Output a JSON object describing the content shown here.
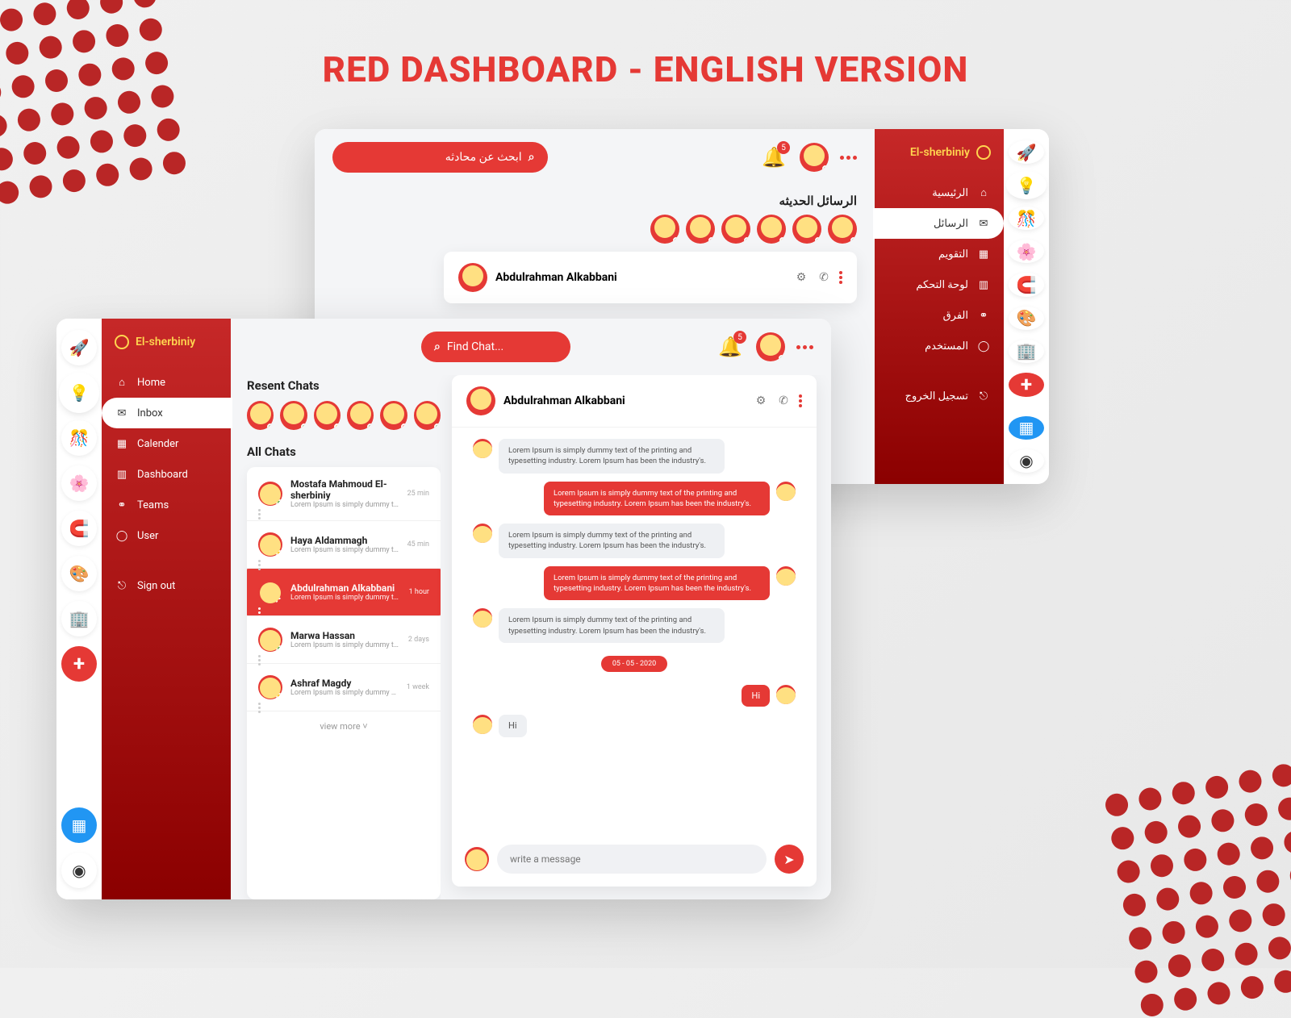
{
  "title": "RED DASHBOARD - ENGLISH VERSION",
  "accent": "#E53935",
  "english": {
    "brand": "El-sherbiniy",
    "search_placeholder": "Find Chat...",
    "notif_count": "5",
    "nav": [
      "Home",
      "Inbox",
      "Calender",
      "Dashboard",
      "Teams",
      "User"
    ],
    "signout": "Sign out",
    "recent_title": "Resent Chats",
    "all_title": "All Chats",
    "chats": [
      {
        "name": "Mostafa Mahmoud El-sherbiniy",
        "preview": "Lorem Ipsum is simply dummy text of the printing",
        "time": "25 min"
      },
      {
        "name": "Haya Aldammagh",
        "preview": "Lorem Ipsum is simply dummy text of the printing",
        "time": "45 min"
      },
      {
        "name": "Abdulrahman Alkabbani",
        "preview": "Lorem Ipsum is simply dummy text of the printing",
        "time": "1 hour"
      },
      {
        "name": "Marwa Hassan",
        "preview": "Lorem Ipsum is simply dummy text of the printing",
        "time": "2 days"
      },
      {
        "name": "Ashraf Magdy",
        "preview": "Lorem Ipsum is simply dummy text of the printing",
        "time": "1 week"
      }
    ],
    "view_more": "view more",
    "conversation": {
      "title": "Abdulrahman Alkabbani",
      "messages": [
        {
          "mine": false,
          "text": "Lorem Ipsum is simply dummy text of the printing and typesetting industry. Lorem Ipsum has been the industry's."
        },
        {
          "mine": true,
          "text": "Lorem Ipsum is simply dummy text of the printing and typesetting industry. Lorem Ipsum has been the industry's."
        },
        {
          "mine": false,
          "text": "Lorem Ipsum is simply dummy text of the printing and typesetting industry. Lorem Ipsum has been the industry's."
        },
        {
          "mine": true,
          "text": "Lorem Ipsum is simply dummy text of the printing and typesetting industry. Lorem Ipsum has been the industry's."
        },
        {
          "mine": false,
          "text": "Lorem Ipsum is simply dummy text of the printing and typesetting industry. Lorem Ipsum has been the industry's."
        }
      ],
      "date": "05 - 05 - 2020",
      "hi_mine": "Hi",
      "hi_them": "Hi",
      "compose_placeholder": "write a message"
    }
  },
  "arabic": {
    "brand": "El-sherbiniy",
    "search_placeholder": "ابحث عن محادثه",
    "notif_count": "5",
    "recent_title": "الرسائل الحديثه",
    "nav": [
      "الرئيسية",
      "الرسائل",
      "التقويم",
      "لوحة التحكم",
      "الفرق",
      "المستخدم"
    ],
    "signout": "تسجيل الخروج",
    "conversation_title": "Abdulrahman Alkabbani"
  },
  "dot_statuses": [
    "g",
    "g",
    "y",
    "g",
    "r",
    "g"
  ]
}
